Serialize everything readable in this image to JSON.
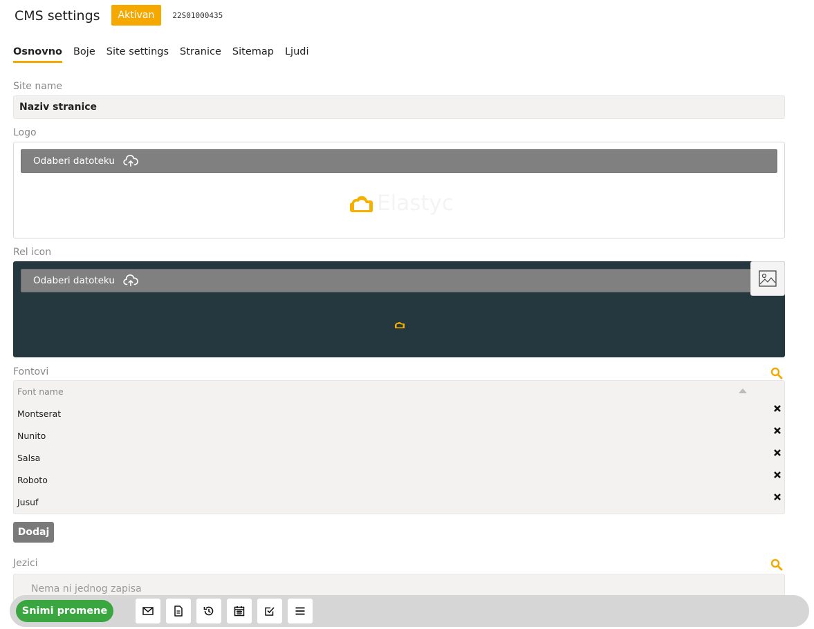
{
  "header": {
    "title": "CMS settings",
    "status": "Aktivan",
    "record_id": "22S01000435"
  },
  "tabs": [
    {
      "label": "Osnovno",
      "active": true
    },
    {
      "label": "Boje"
    },
    {
      "label": "Site settings"
    },
    {
      "label": "Stranice"
    },
    {
      "label": "Sitemap"
    },
    {
      "label": "Ljudi"
    }
  ],
  "site_name": {
    "label": "Site name",
    "value": "Naziv stranice"
  },
  "logo": {
    "label": "Logo",
    "upload_label": "Odaberi datoteku",
    "preview_text": "Elastyc"
  },
  "rel_icon": {
    "label": "Rel icon",
    "upload_label": "Odaberi datoteku"
  },
  "fonts": {
    "label": "Fontovi",
    "column_header": "Font name",
    "rows": [
      "Montserat",
      "Nunito",
      "Salsa",
      "Roboto",
      "Jusuf"
    ],
    "add_label": "Dodaj"
  },
  "languages": {
    "label": "Jezici",
    "empty_text": "Nema ni jednog zapisa"
  },
  "footer": {
    "save_label": "Snimi promene",
    "tools": [
      "mail-icon",
      "document-icon",
      "history-icon",
      "calendar-icon",
      "checkbox-icon",
      "menu-icon"
    ]
  },
  "colors": {
    "accent": "#f5a800",
    "save_green": "#3aa640",
    "dark_panel": "#253840",
    "upload_bar": "#808080"
  }
}
